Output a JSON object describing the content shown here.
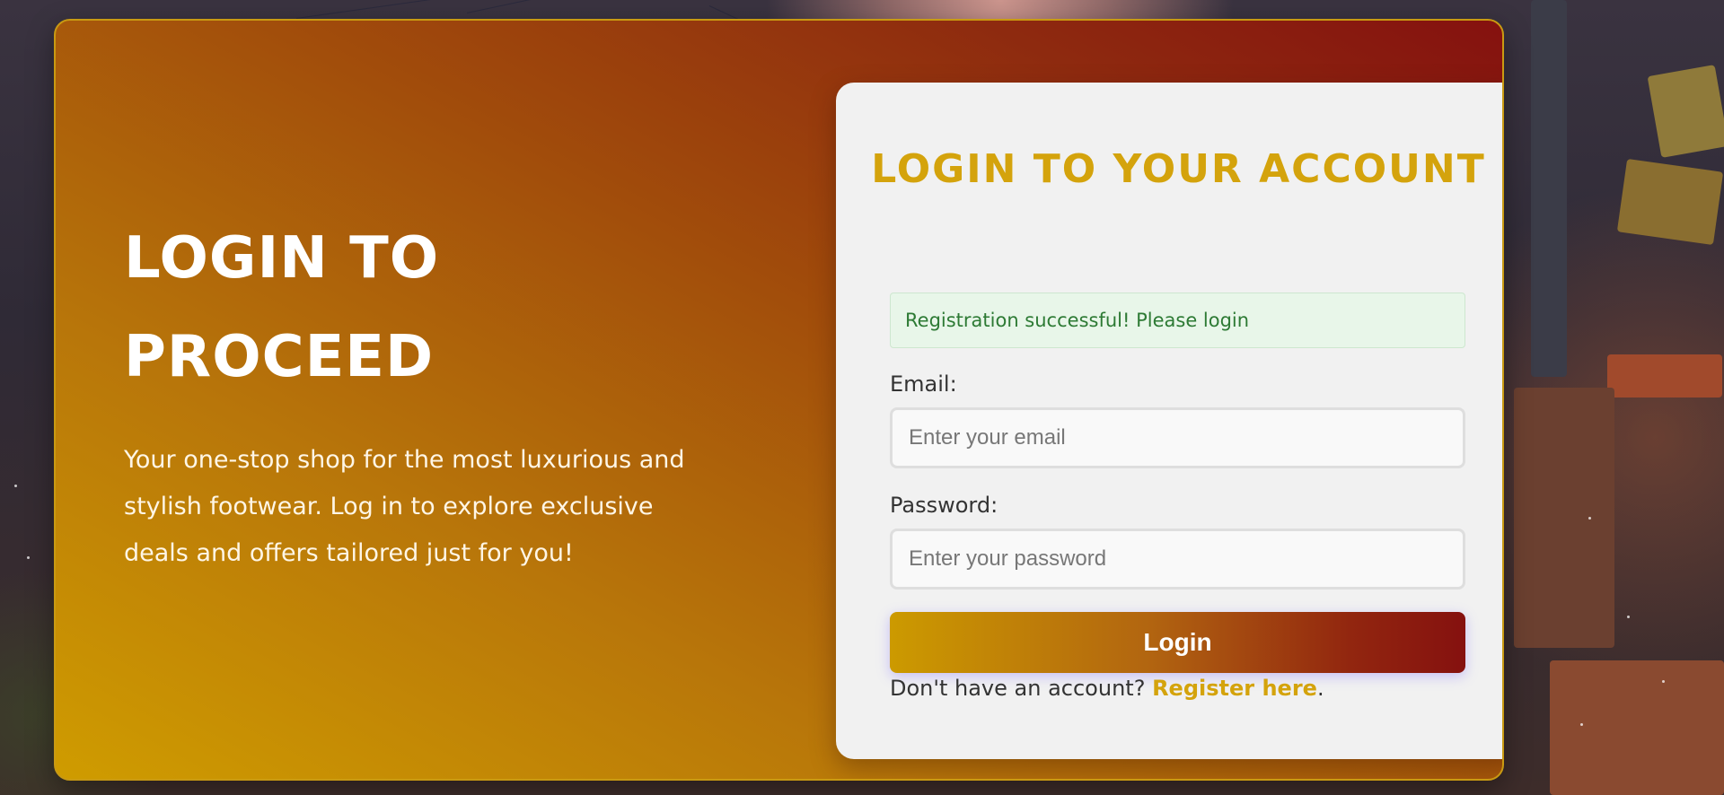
{
  "hero": {
    "heading": "LOGIN TO PROCEED",
    "description": "Your one-stop shop for the most luxurious and stylish footwear. Log in to explore exclusive deals and offers tailored just for you!"
  },
  "login_form": {
    "title": "LOGIN TO YOUR ACCOUNT",
    "alert": "Registration successful! Please login",
    "email_label": "Email:",
    "email_placeholder": "Enter your email",
    "email_value": "",
    "password_label": "Password:",
    "password_placeholder": "Enter your password",
    "password_value": "",
    "submit_label": "Login",
    "register_prompt": "Don't have an account?",
    "register_link": "Register here",
    "register_suffix": "."
  },
  "colors": {
    "accent": "#d4a30c",
    "gradient_start": "#cf9c00",
    "gradient_end": "#85110f",
    "card_background": "#f1f1f1",
    "success_text": "#2d7a34",
    "success_background": "#e8f6e9"
  }
}
